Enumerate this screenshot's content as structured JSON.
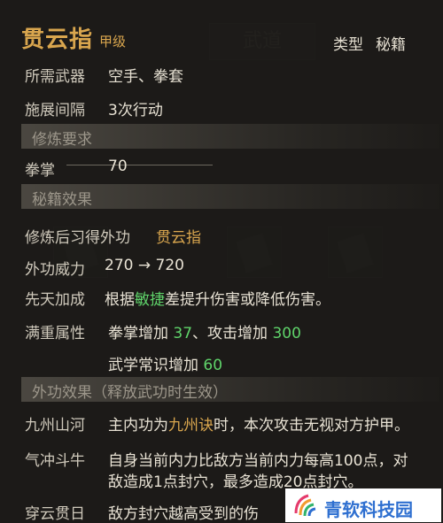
{
  "header": {
    "title": "贯云指",
    "grade": "甲级",
    "type_label": "类型",
    "type_value": "秘籍"
  },
  "background_tabs": [
    "武道"
  ],
  "requirements": {
    "weapon_label": "所需武器",
    "weapon_value": "空手、拳套",
    "interval_label": "施展间隔",
    "interval_value": "3次行动"
  },
  "training": {
    "header": "修炼要求",
    "skill_label": "拳掌",
    "skill_value": "70"
  },
  "manual": {
    "header": "秘籍效果",
    "learn_label": "修炼后习得外功",
    "learn_value": "贯云指",
    "power_label": "外功威力",
    "power_value": "270 → 720",
    "innate_label": "先天加成",
    "innate_prefix": "根据",
    "innate_stat": "敏捷",
    "innate_suffix": "差提升伤害或降低伤害。",
    "full_label": "满重属性",
    "full_1_prefix": "拳掌增加",
    "full_1_value": "37",
    "full_1_mid": "、攻击增加",
    "full_1_value2": "300",
    "full_2_prefix": "武学常识增加",
    "full_2_value": "60"
  },
  "effects": {
    "header": "外功效果（释放武功时生效）",
    "e1_label": "九州山河",
    "e1_prefix": "主内功为",
    "e1_highlight": "九州诀",
    "e1_suffix": "时，本次攻击无视对方护甲。",
    "e2_label": "气冲斗牛",
    "e2_line1": "自身当前内力比敌方当前内力每高100点，对",
    "e2_line2": "敌造成1点封穴，最多造成20点封穴。",
    "e3_label": "穿云贯日",
    "e3_line1": "敌方封穴越高受到的伤"
  },
  "watermark": {
    "text": "青软科技园"
  },
  "colors": {
    "gold": "#d9a64e",
    "green": "#5fd36a",
    "text": "#e8e2d4"
  }
}
